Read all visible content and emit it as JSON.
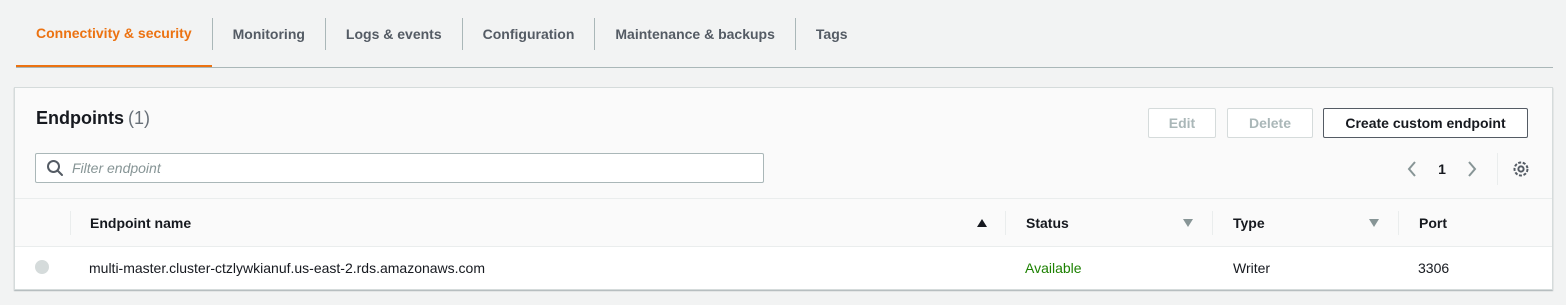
{
  "tabs": [
    {
      "label": "Connectivity & security",
      "active": true
    },
    {
      "label": "Monitoring"
    },
    {
      "label": "Logs & events"
    },
    {
      "label": "Configuration"
    },
    {
      "label": "Maintenance & backups"
    },
    {
      "label": "Tags"
    }
  ],
  "endpoints": {
    "title": "Endpoints",
    "count": "(1)",
    "buttons": {
      "edit": "Edit",
      "delete": "Delete",
      "create": "Create custom endpoint"
    },
    "filter": {
      "placeholder": "Filter endpoint",
      "value": ""
    },
    "pagination": {
      "current_page": "1"
    },
    "columns": {
      "name": "Endpoint name",
      "status": "Status",
      "type": "Type",
      "port": "Port"
    },
    "rows": [
      {
        "name": "multi-master.cluster-ctzlywkianuf.us-east-2.rds.amazonaws.com",
        "status": "Available",
        "type": "Writer",
        "port": "3306"
      }
    ]
  },
  "colors": {
    "accent": "#ec7211",
    "status_available": "#1d8102",
    "text_primary": "#16191f",
    "text_secondary": "#545b64"
  },
  "icons": {
    "search": "search-icon",
    "prev": "chevron-left-icon",
    "next": "chevron-right-icon",
    "settings": "gear-icon",
    "sort_asc": "caret-up-icon",
    "sort_desc": "caret-down-icon"
  }
}
